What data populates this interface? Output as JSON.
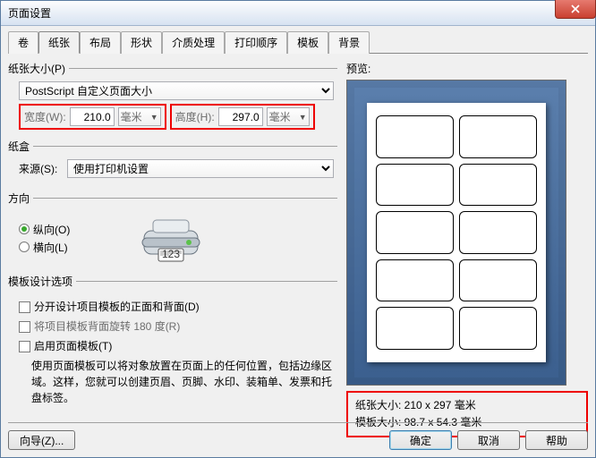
{
  "title": "页面设置",
  "tabs": [
    "卷",
    "纸张",
    "布局",
    "形状",
    "介质处理",
    "打印顺序",
    "模板",
    "背景"
  ],
  "active_tab": 1,
  "paper_size": {
    "group": "纸张大小(P)",
    "select": "PostScript 自定义页面大小",
    "width_label": "宽度(W):",
    "width_value": "210.0",
    "height_label": "高度(H):",
    "height_value": "297.0",
    "unit": "毫米"
  },
  "tray": {
    "group": "纸盒",
    "source_label": "来源(S):",
    "source_value": "使用打印机设置"
  },
  "orientation": {
    "group": "方向",
    "portrait": "纵向(O)",
    "landscape": "横向(L)",
    "selected": "portrait"
  },
  "template": {
    "group": "模板设计选项",
    "chk1": "分开设计项目模板的正面和背面(D)",
    "chk2": "将项目模板背面旋转 180 度(R)",
    "chk3": "启用页面模板(T)",
    "help": "使用页面模板可以将对象放置在页面上的任何位置，包括边缘区域。这样，您就可以创建页眉、页脚、水印、装箱单、发票和托盘标签。"
  },
  "preview": {
    "label": "预览:",
    "paper_line": "纸张大小: 210 x 297 毫米",
    "template_line": "模板大小: 98.7 x 54.3 毫米"
  },
  "footer": {
    "wizard": "向导(Z)...",
    "ok": "确定",
    "cancel": "取消",
    "help": "帮助"
  }
}
